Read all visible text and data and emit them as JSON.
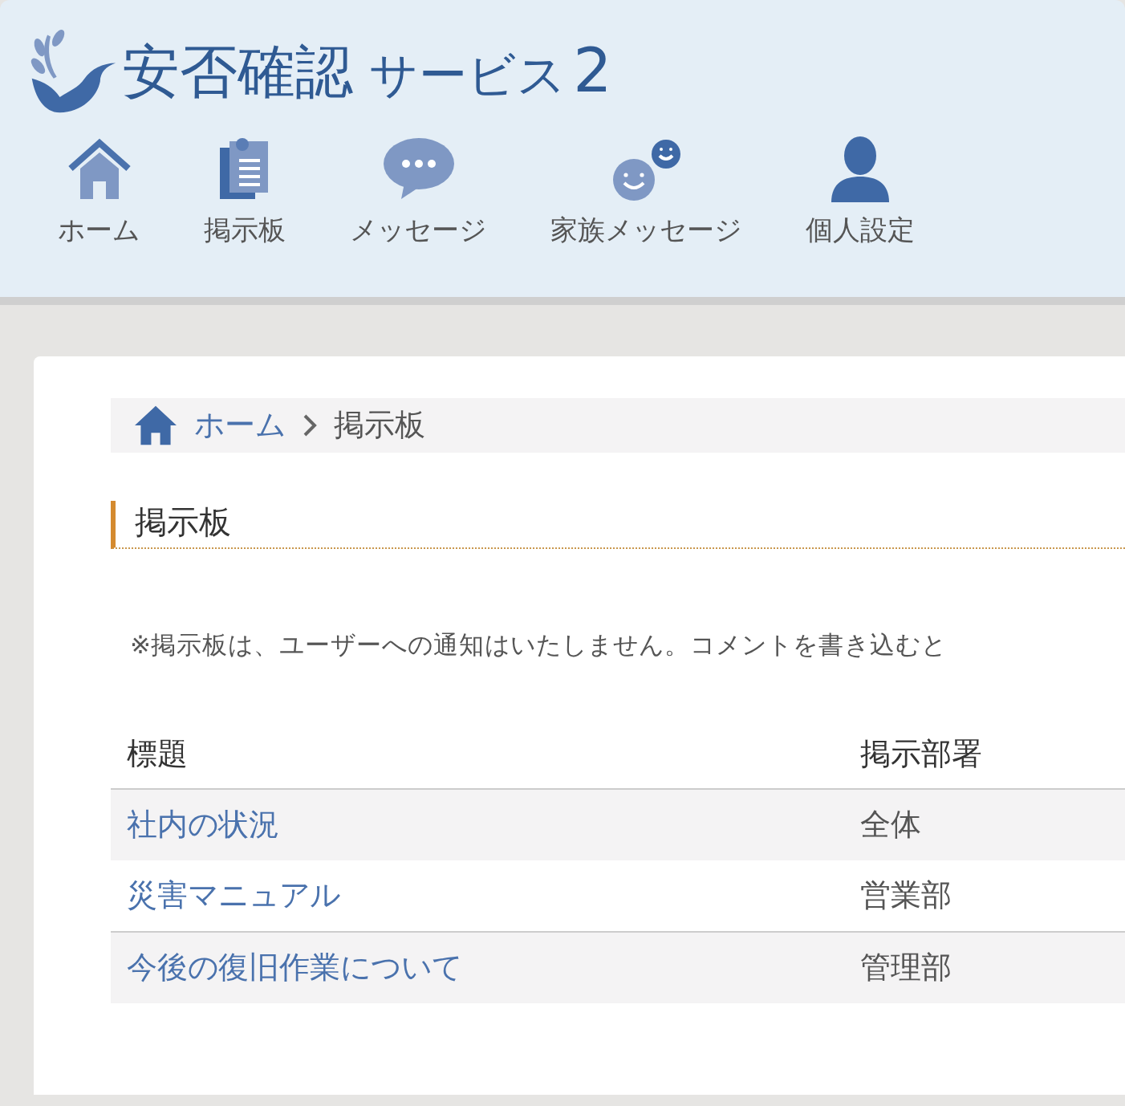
{
  "app_title": {
    "main": "安否確認",
    "sub": "サービス",
    "number": "2"
  },
  "nav": [
    {
      "kind": "home",
      "label": "ホーム"
    },
    {
      "kind": "board",
      "label": "掲示板"
    },
    {
      "kind": "message",
      "label": "メッセージ"
    },
    {
      "kind": "family",
      "label": "家族メッセージ"
    },
    {
      "kind": "person",
      "label": "個人設定"
    }
  ],
  "breadcrumb": [
    {
      "label": "ホーム",
      "link": true
    },
    {
      "label": "掲示板",
      "link": false
    }
  ],
  "page_title": "掲示板",
  "note": "※掲示板は、ユーザーへの通知はいたしません。コメントを書き込むと",
  "table": {
    "columns": [
      "標題",
      "掲示部署"
    ],
    "rows": [
      {
        "title": "社内の状況",
        "department": "全体"
      },
      {
        "title": "災害マニュアル",
        "department": "営業部"
      },
      {
        "title": "今後の復旧作業について",
        "department": "管理部"
      }
    ]
  }
}
